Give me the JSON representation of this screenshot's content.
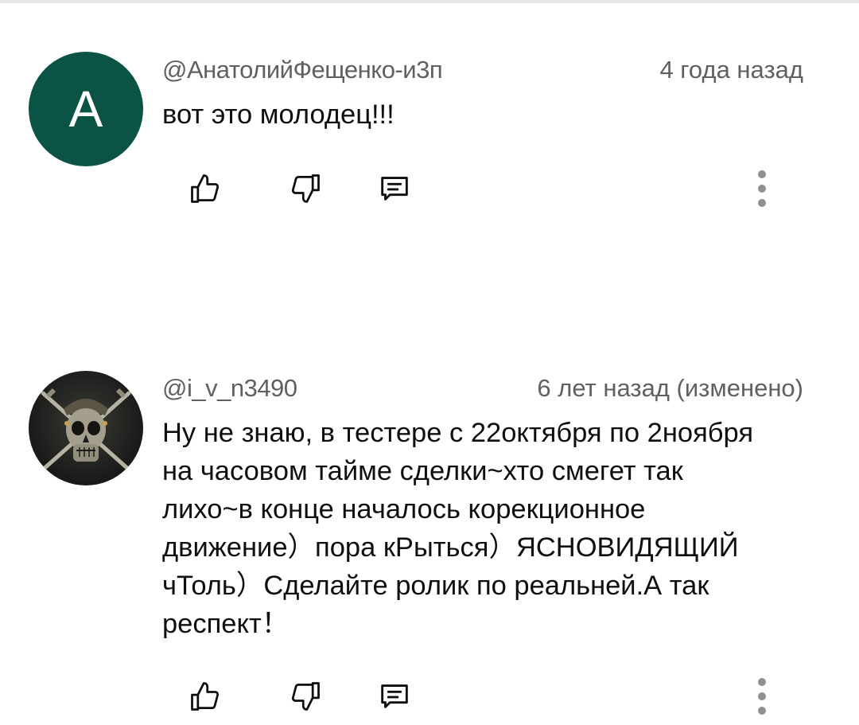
{
  "comments": [
    {
      "avatar_letter": "A",
      "avatar_color": "#0b5345",
      "author": "@АнатолийФещенко-и3п",
      "time": "4 года назад",
      "edited": "",
      "text": "вот это молодец!!!",
      "actions": {
        "like_icon": "thumb-up-icon",
        "dislike_icon": "thumb-down-icon",
        "reply_icon": "reply-icon",
        "more_icon": "more-vert-icon"
      }
    },
    {
      "avatar_image": "skull-crossbones",
      "author": "@i_v_n3490",
      "time": "6 лет назад",
      "edited": "(изменено)",
      "text_lines": [
        "Ну не знаю, в тестере с 22октября по 2ноября",
        "на часовом тайме сделки~хто смегет так",
        "лихо~в конце началось корекционное",
        "движение）пора кРыться）ЯСНОВИДЯЩИЙ",
        "чТоль）Сделайте ролик по реальней.А так",
        "респект！"
      ],
      "actions": {
        "like_icon": "thumb-up-icon",
        "dislike_icon": "thumb-down-icon",
        "reply_icon": "reply-icon",
        "more_icon": "more-vert-icon"
      }
    }
  ],
  "colors": {
    "text_primary": "#0f0f0f",
    "text_secondary": "#606060",
    "icon": "#0f0f0f",
    "more_dots": "#909090"
  }
}
